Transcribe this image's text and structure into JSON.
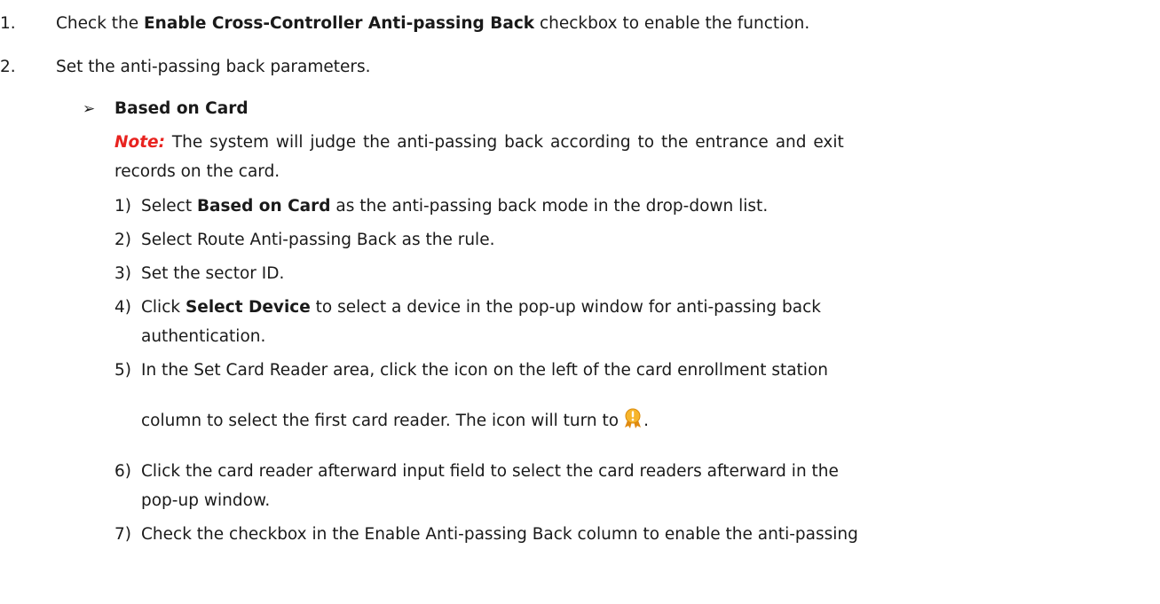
{
  "steps": [
    {
      "num": "1.",
      "pre": "Check the ",
      "bold": "Enable Cross-Controller Anti-passing Back",
      "post": " checkbox to enable the function."
    },
    {
      "num": "2.",
      "text": "Set the anti-passing back parameters."
    }
  ],
  "bullet": {
    "marker": "➢",
    "title": "Based on Card"
  },
  "note": {
    "label": "Note:",
    "line1": " The system will judge the anti-passing back according to the entrance and exit",
    "line2": "records on the card."
  },
  "substeps": [
    {
      "num": "1)",
      "pre": "Select ",
      "bold": "Based on Card",
      "post": " as the anti-passing back mode in the drop-down list."
    },
    {
      "num": "2)",
      "text": "Select Route Anti-passing Back as the rule."
    },
    {
      "num": "3)",
      "text": "Set the sector ID."
    },
    {
      "num": "4)",
      "pre": "Click ",
      "bold": "Select Device",
      "post": " to select a device in the pop-up window for anti-passing back",
      "line2": "authentication."
    },
    {
      "num": "5)",
      "text": "In the Set Card Reader area, click the icon on the left of the card enrollment station",
      "line2": "column to select the first card reader. The icon will turn to",
      "line2_end": "."
    },
    {
      "num": "6)",
      "text": "Click the card reader afterward input field to select the card readers afterward in the",
      "line2": "pop-up window."
    },
    {
      "num": "7)",
      "text": "Check the checkbox in the Enable Anti-passing Back column to enable the anti-passing"
    }
  ],
  "icons": {
    "reader_icon": "card-reader-warning-icon",
    "icon_color": "#f0a020"
  }
}
